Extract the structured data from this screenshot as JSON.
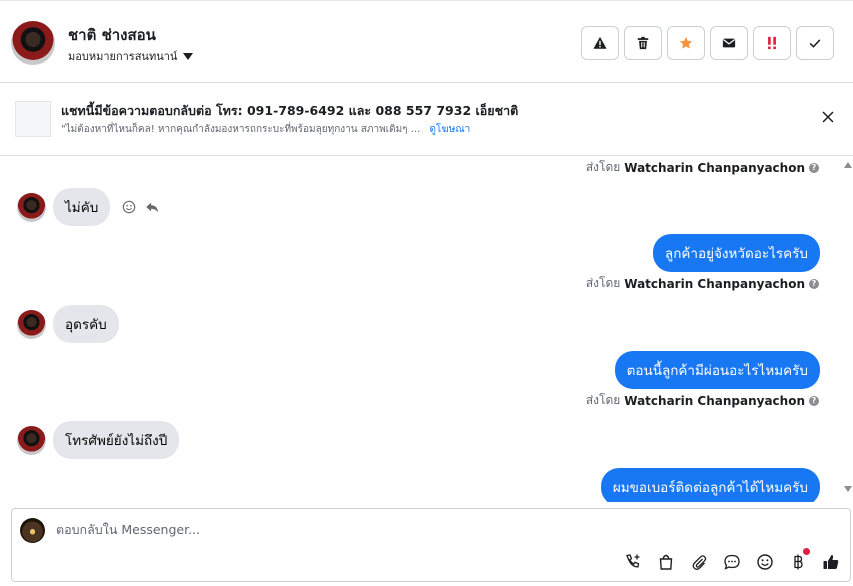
{
  "header": {
    "contact_name": "ชาติ ช่างสอน",
    "assign_label": "มอบหมายการสนทนาน์"
  },
  "banner": {
    "title": "แชทนี้มีข้อความตอบกลับต่อ โทร: 091-789-6492 และ 088 557 7932 เอ็ยชาติ",
    "subtitle": "\"ไม่ต้องหาที่ไหนก็คล! หากคุณกำลังมองหารถกระบะที่พร้อมลุยทุกงาน สภาพเดิมๆ ...",
    "link": "ดูโฆษณา"
  },
  "messages": {
    "sent_by_prefix": "ส่งโดย",
    "agent_name": "Watcharin Chanpanyachon",
    "in_1": "ไม่คับ",
    "out_1": "ลูกค้าอยู่จังหวัดอะไรครับ",
    "in_2": "อุดรคับ",
    "out_2": "ตอนนี้ลูกค้ามีผ่อนอะไรไหมครับ",
    "in_3": "โทรศัพย์ยังไม่ถึงปี",
    "out_3": "ผมขอเบอร์ติดต่อลูกค้าได้ไหมครับ"
  },
  "composer": {
    "placeholder": "ตอบกลับใน Messenger..."
  },
  "colors": {
    "accent": "#1877f2",
    "star": "#f7923a",
    "urgent": "#e41e3f",
    "incoming_bubble": "#e4e6eb"
  }
}
